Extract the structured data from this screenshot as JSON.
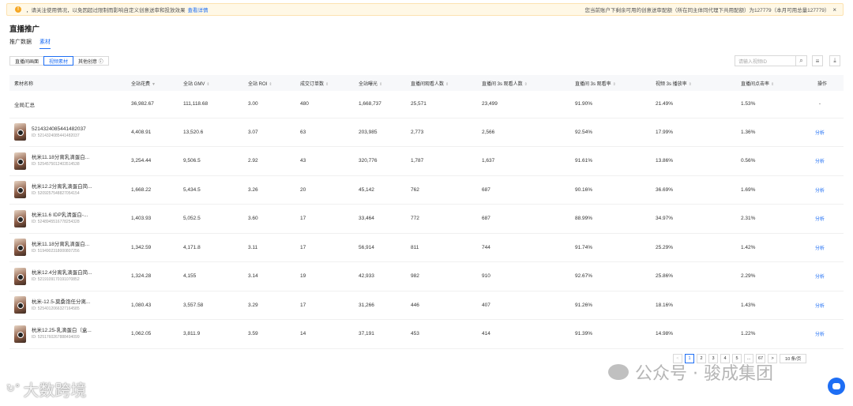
{
  "notice": {
    "text": "，请关注使用情况，以免因超过限制而影响自定义创意送审和投放效果",
    "link": "查看详情",
    "right_text": "您当前账户下剩余可用的创意送审配额（所在同主体同代理下共用配额）为127779（本月可用总量127779）",
    "close": "×"
  },
  "page": {
    "title": "直播推广",
    "subtabs": [
      "推广数据",
      "素材"
    ],
    "active_subtab": "素材"
  },
  "toolbar": {
    "tabs": [
      "直播间画面",
      "视频素材",
      "其他创意 ⓘ"
    ],
    "active": "视频素材"
  },
  "search": {
    "placeholder": "请输入视频ID"
  },
  "table": {
    "headers": [
      "素材名称",
      "全站花费",
      "全站 GMV",
      "全站 ROI",
      "成交订单数",
      "全站曝光",
      "直播间观看人数",
      "直播间 3s 观看人数",
      "直播间 3s 观看率",
      "视频 3s 播放率",
      "直播间点击率",
      "操作"
    ],
    "summary": [
      "全局汇总",
      "36,982.67",
      "111,118.68",
      "3.00",
      "480",
      "1,668,737",
      "25,571",
      "23,499",
      "91.90%",
      "21.49%",
      "1.53%",
      "-"
    ],
    "action_label": "分析",
    "rows": [
      {
        "name": "5214324085441482037",
        "id": "ID: 5214324085441482037",
        "vals": [
          "4,408.91",
          "13,520.6",
          "3.07",
          "63",
          "203,985",
          "2,773",
          "2,566",
          "92.54%",
          "17.99%",
          "1.36%"
        ]
      },
      {
        "name": "杭米11.18分离乳滴蛋白...",
        "id": "ID: 5254575012403514538",
        "vals": [
          "3,254.44",
          "9,506.5",
          "2.92",
          "43",
          "320,776",
          "1,787",
          "1,637",
          "91.61%",
          "13.86%",
          "0.56%"
        ]
      },
      {
        "name": "杭米12.2分离乳滴蛋白简...",
        "id": "ID: 5209257548827054154",
        "vals": [
          "1,668.22",
          "5,434.5",
          "3.26",
          "20",
          "45,142",
          "762",
          "687",
          "90.16%",
          "36.69%",
          "1.69%"
        ]
      },
      {
        "name": "杭米11.6 IDP乳清蛋白-...",
        "id": "ID: 5248945516778254328",
        "vals": [
          "1,403.93",
          "5,052.5",
          "3.60",
          "17",
          "33,464",
          "772",
          "687",
          "88.99%",
          "34.97%",
          "2.31%"
        ]
      },
      {
        "name": "杭米11.18分离乳滴蛋白...",
        "id": "ID: 5194902318000807256",
        "vals": [
          "1,342.59",
          "4,171.8",
          "3.11",
          "17",
          "56,914",
          "811",
          "744",
          "91.74%",
          "25.29%",
          "1.42%"
        ]
      },
      {
        "name": "杭米12.4分离乳滴蛋白简...",
        "id": "ID: 5219109170191070852",
        "vals": [
          "1,324.28",
          "4,155",
          "3.14",
          "19",
          "42,933",
          "982",
          "910",
          "92.67%",
          "25.86%",
          "2.29%"
        ]
      },
      {
        "name": "杭米-12.5-莫桑饱任分离...",
        "id": "ID: 5254012066327164585",
        "vals": [
          "1,080.43",
          "3,557.58",
          "3.29",
          "17",
          "31,266",
          "446",
          "407",
          "91.26%",
          "18.16%",
          "1.43%"
        ]
      },
      {
        "name": "杭米12.25-乳滴蛋白（盒...",
        "id": "ID: 5251760267888494099",
        "vals": [
          "1,062.05",
          "3,811.9",
          "3.59",
          "14",
          "37,191",
          "453",
          "414",
          "91.39%",
          "14.98%",
          "1.22%"
        ]
      }
    ]
  },
  "pager": {
    "prev": "<",
    "pages": [
      "1",
      "2",
      "3",
      "4",
      "5",
      "...",
      "67",
      ">"
    ],
    "active": "1",
    "size": "10 条/页"
  },
  "watermarks": {
    "wechat": "公众号 · 骏成集团",
    "logo_text": "大数跨境"
  },
  "colors": {
    "accent": "#1e6ef4",
    "warning": "#f5a623"
  }
}
